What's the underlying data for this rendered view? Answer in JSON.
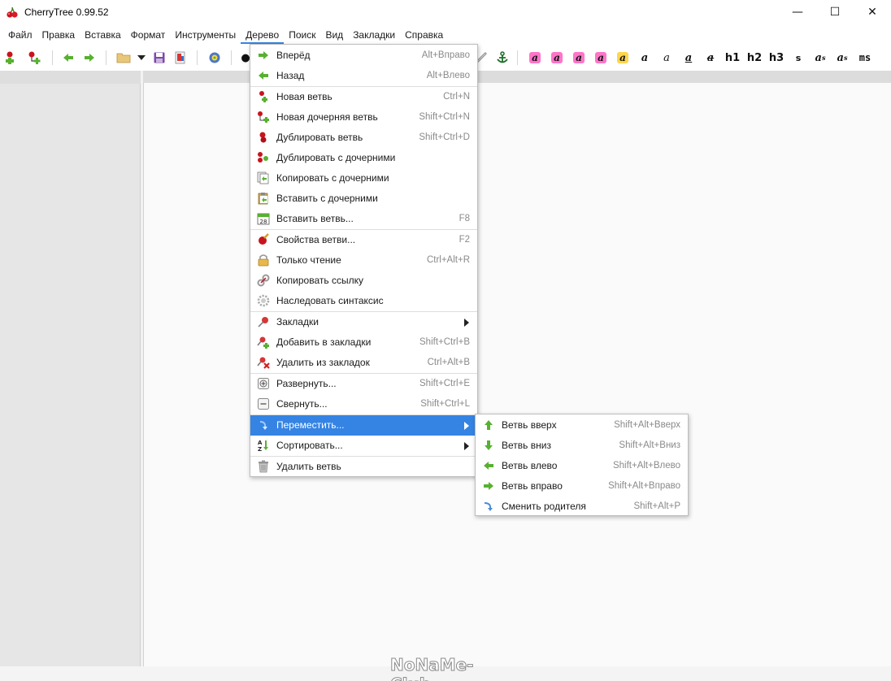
{
  "window": {
    "title": "CherryTree 0.99.52",
    "minimize": "—",
    "maximize": "☐",
    "close": "✕"
  },
  "menubar": [
    {
      "name": "menu-file",
      "label": "Файл"
    },
    {
      "name": "menu-edit",
      "label": "Правка"
    },
    {
      "name": "menu-insert",
      "label": "Вставка"
    },
    {
      "name": "menu-format",
      "label": "Формат"
    },
    {
      "name": "menu-tools",
      "label": "Инструменты"
    },
    {
      "name": "menu-tree",
      "label": "Дерево",
      "active": true
    },
    {
      "name": "menu-search",
      "label": "Поиск"
    },
    {
      "name": "menu-view",
      "label": "Вид"
    },
    {
      "name": "menu-bookmarks",
      "label": "Закладки"
    },
    {
      "name": "menu-help",
      "label": "Справка"
    }
  ],
  "toolbar": {
    "headings": [
      "h1",
      "h2",
      "h3"
    ],
    "small": "s",
    "superscript": "a",
    "superscript_mark": "s",
    "subscript": "a",
    "subscript_mark": "s",
    "monospace": "ms",
    "bold": "a",
    "italic": "a",
    "underline": "a",
    "strikethrough": "a",
    "highlight_glyph": "a",
    "bullet": "●",
    "highlight_colors": [
      "#ff74c8",
      "#ff74c8",
      "#ff74c8",
      "#ff74c8",
      "#ffd54a"
    ]
  },
  "tree_menu": {
    "items": [
      {
        "label": "Вперёд",
        "accel": "Alt+Вправо",
        "icon": "arrow-right-icon"
      },
      {
        "label": "Назад",
        "accel": "Alt+Влево",
        "icon": "arrow-left-icon"
      },
      {
        "label": "Новая ветвь",
        "accel": "Ctrl+N",
        "icon": "new-node-icon"
      },
      {
        "label": "Новая дочерняя ветвь",
        "accel": "Shift+Ctrl+N",
        "icon": "new-child-node-icon"
      },
      {
        "label": "Дублировать ветвь",
        "accel": "Shift+Ctrl+D",
        "icon": "duplicate-node-icon"
      },
      {
        "label": "Дублировать с дочерними",
        "accel": "",
        "icon": "duplicate-subtree-icon"
      },
      {
        "label": "Копировать с дочерними",
        "accel": "",
        "icon": "copy-subtree-icon"
      },
      {
        "label": "Вставить с дочерними",
        "accel": "",
        "icon": "paste-subtree-icon"
      },
      {
        "label": "Вставить ветвь...",
        "accel": "F8",
        "icon": "calendar-icon"
      },
      {
        "label": "Свойства ветви...",
        "accel": "F2",
        "icon": "node-properties-icon"
      },
      {
        "label": "Только чтение",
        "accel": "Ctrl+Alt+R",
        "icon": "lock-icon"
      },
      {
        "label": "Копировать ссылку",
        "accel": "",
        "icon": "link-icon"
      },
      {
        "label": "Наследовать синтаксис",
        "accel": "",
        "icon": "gear-icon"
      },
      {
        "label": "Закладки",
        "accel": "",
        "icon": "pushpin-icon",
        "submenu": true
      },
      {
        "label": "Добавить в закладки",
        "accel": "Shift+Ctrl+B",
        "icon": "bookmark-add-icon"
      },
      {
        "label": "Удалить из закладок",
        "accel": "Ctrl+Alt+B",
        "icon": "bookmark-remove-icon"
      },
      {
        "label": "Развернуть...",
        "accel": "Shift+Ctrl+E",
        "icon": "expand-icon"
      },
      {
        "label": "Свернуть...",
        "accel": "Shift+Ctrl+L",
        "icon": "collapse-icon"
      },
      {
        "label": "Переместить...",
        "accel": "",
        "icon": "move-icon",
        "submenu": true,
        "selected": true
      },
      {
        "label": "Сортировать...",
        "accel": "",
        "icon": "sort-az-icon",
        "submenu": true
      },
      {
        "label": "Удалить ветвь",
        "accel": "",
        "icon": "trash-icon"
      }
    ]
  },
  "move_submenu": {
    "items": [
      {
        "label": "Ветвь вверх",
        "accel": "Shift+Alt+Вверх",
        "icon": "arrow-up-icon"
      },
      {
        "label": "Ветвь вниз",
        "accel": "Shift+Alt+Вниз",
        "icon": "arrow-down-icon"
      },
      {
        "label": "Ветвь влево",
        "accel": "Shift+Alt+Влево",
        "icon": "arrow-left-icon"
      },
      {
        "label": "Ветвь вправо",
        "accel": "Shift+Alt+Вправо",
        "icon": "arrow-right-icon"
      },
      {
        "label": "Сменить родителя",
        "accel": "Shift+Alt+P",
        "icon": "change-parent-icon"
      }
    ]
  },
  "watermark": "NoNaMe-Club",
  "colors": {
    "selection": "#3584e4",
    "green_arrow": "#58b030",
    "cherry": "#c8141e"
  }
}
